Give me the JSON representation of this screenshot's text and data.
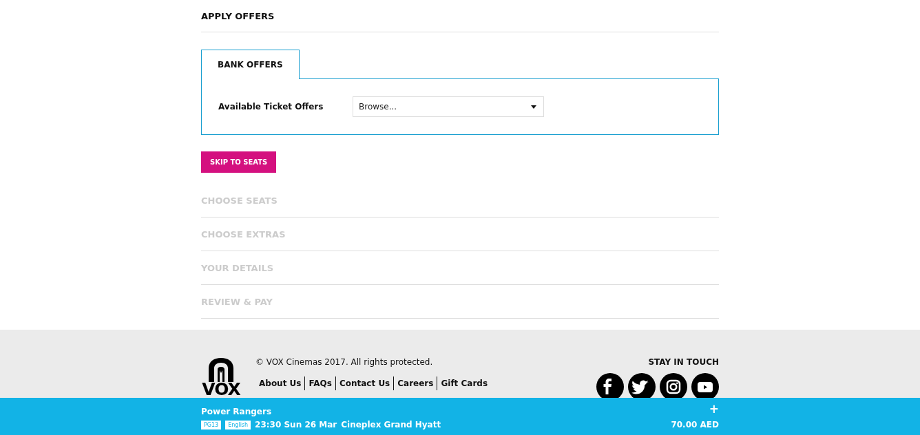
{
  "steps": [
    {
      "label": "APPLY OFFERS",
      "active": true
    },
    {
      "label": "CHOOSE SEATS",
      "active": false
    },
    {
      "label": "CHOOSE EXTRAS",
      "active": false
    },
    {
      "label": "YOUR DETAILS",
      "active": false
    },
    {
      "label": "REVIEW & PAY",
      "active": false
    }
  ],
  "offer_tabs": [
    {
      "label": "BANK OFFERS",
      "selected": true
    }
  ],
  "offers": {
    "label": "Available Ticket Offers",
    "dropdown": {
      "value": "Browse..."
    }
  },
  "skip_button": "SKIP TO SEATS",
  "footer": {
    "logo_text": "VOX",
    "copyright": "© VOX Cinemas 2017. All rights protected.",
    "links": [
      "About Us",
      "FAQs",
      "Contact Us",
      "Careers",
      "Gift Cards"
    ],
    "social_heading": "STAY IN TOUCH",
    "social": [
      {
        "kind": "facebook"
      },
      {
        "kind": "twitter"
      },
      {
        "kind": "instagram"
      },
      {
        "kind": "youtube"
      }
    ]
  },
  "booking_bar": {
    "movie": "Power Rangers",
    "badges": [
      "PG13",
      "English"
    ],
    "showtime": "23:30 Sun 26 Mar",
    "cinema": "Cineplex Grand Hyatt",
    "expand_icon": "+",
    "total": "70.00 AED"
  }
}
